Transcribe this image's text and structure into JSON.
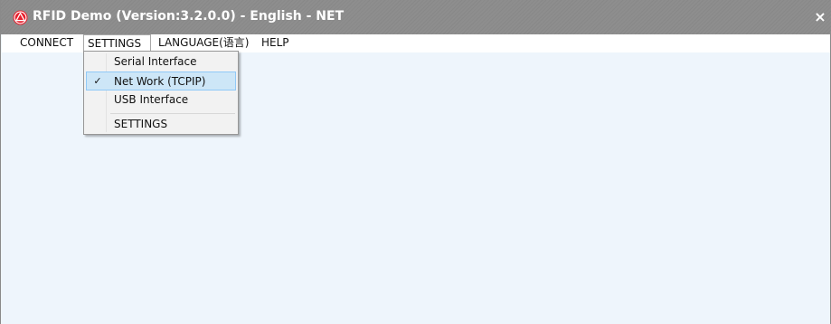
{
  "window": {
    "title": "RFID Demo (Version:3.2.0.0) - English - NET",
    "close_glyph": "×",
    "icon": "app-logo-icon",
    "content_bg": "#eef5fc"
  },
  "menubar": {
    "items": [
      {
        "label": "CONNECT"
      },
      {
        "label": "SETTINGS"
      },
      {
        "label": "LANGUAGE(语言)"
      },
      {
        "label": "HELP"
      }
    ]
  },
  "settings_menu": {
    "items": [
      {
        "label": "Serial Interface",
        "checked": false
      },
      {
        "label": "Net Work (TCPIP)",
        "checked": true,
        "check_glyph": "✓"
      },
      {
        "label": "USB Interface",
        "checked": false
      },
      {
        "label": "SETTINGS",
        "checked": false
      }
    ]
  }
}
